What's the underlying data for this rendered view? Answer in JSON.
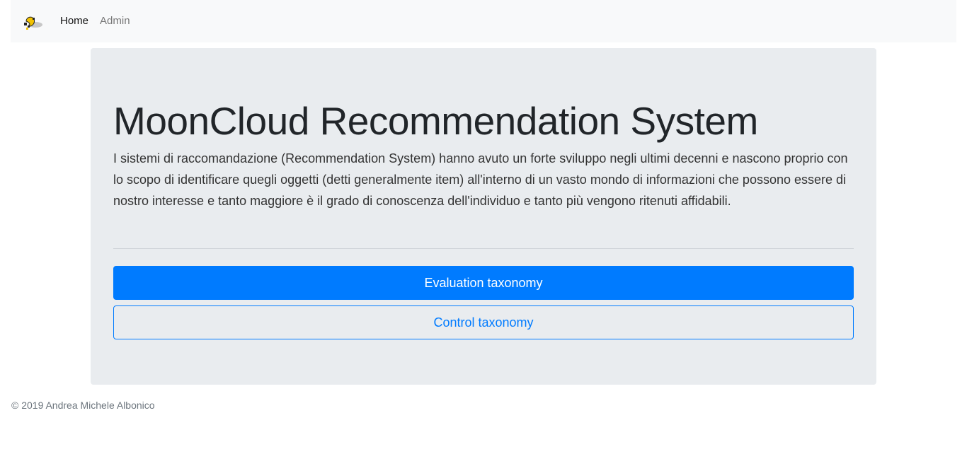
{
  "navbar": {
    "logo_icon": "moon-cloud-logo-icon",
    "links": [
      {
        "label": "Home",
        "active": true
      },
      {
        "label": "Admin",
        "active": false
      }
    ]
  },
  "jumbotron": {
    "title": "MoonCloud Recommendation System",
    "lead": "I sistemi di raccomandazione (Recommendation System) hanno avuto un forte sviluppo negli ultimi decenni e nascono proprio con lo scopo di identificare quegli oggetti (detti generalmente item) all'interno di un vasto mondo di informazioni che possono essere di nostro interesse e tanto maggiore è il grado di conoscenza dell'individuo e tanto più vengono ritenuti affidabili.",
    "buttons": {
      "evaluation": "Evaluation taxonomy",
      "control": "Control taxonomy"
    }
  },
  "footer": {
    "copyright": "© 2019 Andrea Michele Albonico"
  },
  "colors": {
    "primary": "#007bff",
    "navbar_bg": "#f8f9fa",
    "jumbotron_bg": "#e9ecef",
    "muted": "#6c757d"
  }
}
